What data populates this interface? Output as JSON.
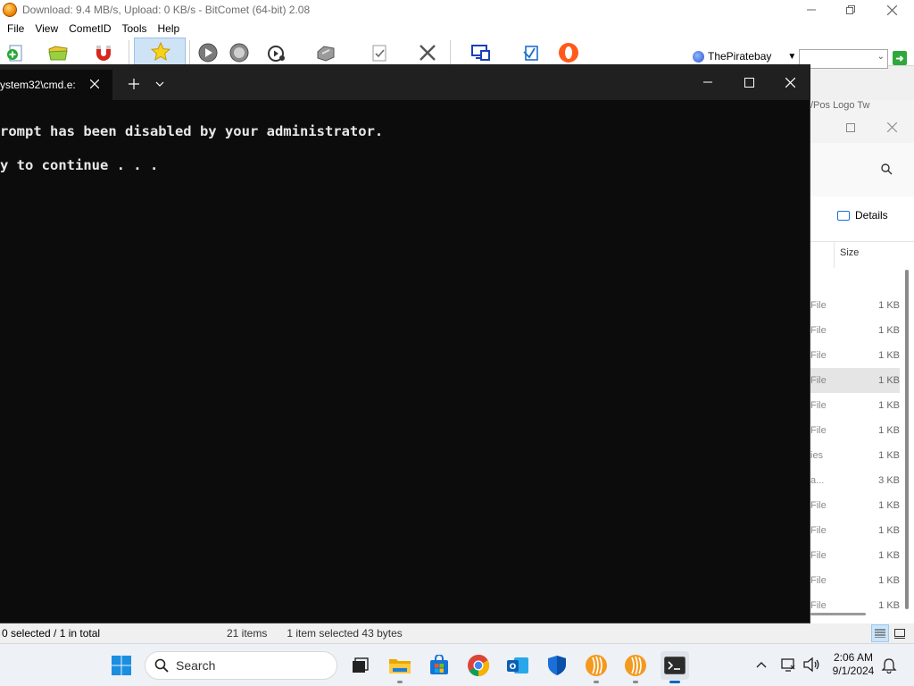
{
  "bitcomet": {
    "title": "Download: 9.4 MB/s, Upload: 0 KB/s - BitComet (64-bit) 2.08",
    "menu": [
      "File",
      "View",
      "CometID",
      "Tools",
      "Help"
    ],
    "search_engine": "ThePiratebay",
    "search_value": "",
    "status_left": "0 selected / 1 in total",
    "toolbar_icons": [
      "add-torrent-icon",
      "open-folder-icon",
      "magnet-icon",
      "favorites-icon",
      "start-icon",
      "stop-icon",
      "preview-icon",
      "properties-icon",
      "checklist-icon",
      "delete-icon",
      "remote-icon",
      "network-icon",
      "opera-icon"
    ]
  },
  "explorer": {
    "header_fragment": "/Pos  Logo Tw",
    "details_label": "Details",
    "col_size": "Size",
    "rows": [
      {
        "type": "File",
        "size": "1 KB"
      },
      {
        "type": "File",
        "size": "1 KB"
      },
      {
        "type": "File",
        "size": "1 KB"
      },
      {
        "type": "File",
        "size": "1 KB"
      },
      {
        "type": "File",
        "size": "1 KB"
      },
      {
        "type": "File",
        "size": "1 KB"
      },
      {
        "type": "ies",
        "size": "1 KB"
      },
      {
        "type": "a...",
        "size": "3 KB"
      },
      {
        "type": "File",
        "size": "1 KB"
      },
      {
        "type": "File",
        "size": "1 KB"
      },
      {
        "type": "File",
        "size": "1 KB"
      },
      {
        "type": "File",
        "size": "1 KB"
      },
      {
        "type": "File",
        "size": "1 KB"
      }
    ],
    "selected_row_index": 3,
    "status_items": "21 items",
    "status_selected": "1 item selected  43 bytes"
  },
  "terminal": {
    "tab_title": "ystem32\\cmd.e:",
    "lines": [
      "rompt has been disabled by your administrator.",
      "y to continue . . ."
    ]
  },
  "taskbar": {
    "search_placeholder": "Search",
    "time": "2:06 AM",
    "date": "9/1/2024",
    "apps": [
      "task-view-icon",
      "file-explorer-icon",
      "microsoft-store-icon",
      "chrome-icon",
      "outlook-icon",
      "defender-icon",
      "bitcomet-icon",
      "bitcomet-icon",
      "terminal-icon"
    ]
  },
  "colors": {
    "terminal_bg": "#0c0c0c",
    "terminal_tabbar": "#202020",
    "accent_blue": "#0067c0"
  }
}
